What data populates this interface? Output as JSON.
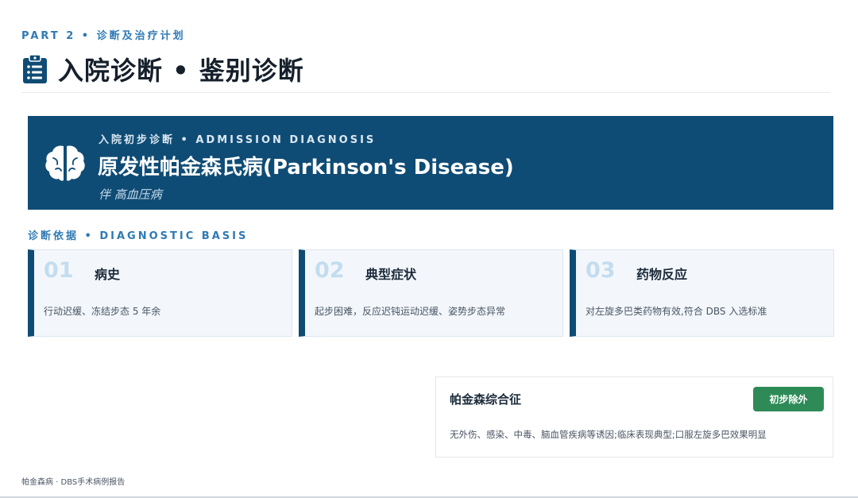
{
  "header": {
    "part_label": "PART 2 • 诊断及治疗计划",
    "title": "入院诊断 • 鉴别诊断"
  },
  "admission": {
    "subtitle": "入院初步诊断 • ADMISSION DIAGNOSIS",
    "diagnosis": "原发性帕金森氏病(Parkinson's Disease)",
    "comorbidity": "伴 高血压病"
  },
  "basis": {
    "label": "诊断依据 • DIAGNOSTIC BASIS",
    "cards": [
      {
        "num": "01",
        "title": "病史",
        "text": "行动迟缓、冻结步态 5 年余"
      },
      {
        "num": "02",
        "title": "典型症状",
        "text": "起步困难，反应迟钝运动迟缓、姿势步态异常"
      },
      {
        "num": "03",
        "title": "药物反应",
        "text": "对左旋多巴类药物有效,符合 DBS 入选标准"
      }
    ]
  },
  "differential": {
    "title": "帕金森综合征",
    "badge": "初步除外",
    "text": "无外伤、感染、中毒、脑血管疾病等诱因;临床表现典型;口服左旋多巴效果明显"
  },
  "footer": {
    "text": "帕金森病 · DBS手术病例报告"
  },
  "icons": {
    "title_icon": "clipboard-icon",
    "banner_icon": "brain-icon"
  },
  "colors": {
    "primary": "#0f4c75",
    "accent": "#2f7ab5",
    "success": "#2e8b57",
    "card_bg": "#f3f7fb"
  }
}
